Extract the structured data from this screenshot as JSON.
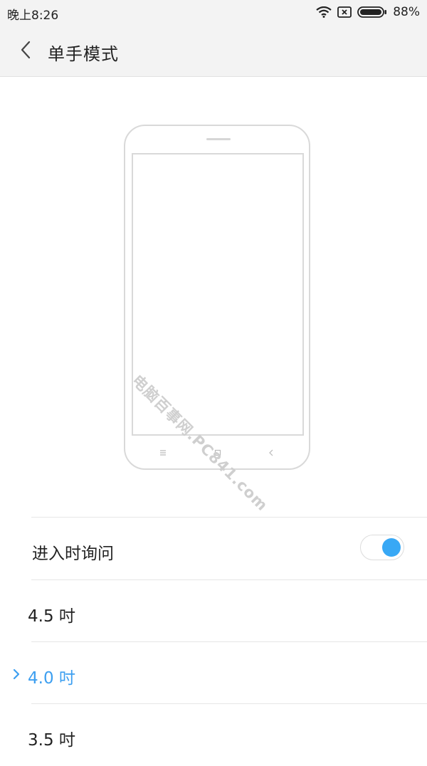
{
  "status_bar": {
    "time": "晚上8:26",
    "battery_percent": "88%",
    "icons": [
      "wifi-icon",
      "no-sim-icon",
      "battery-icon"
    ]
  },
  "header": {
    "title": "单手模式",
    "back_icon": "chevron-left-icon"
  },
  "illustration": {
    "watermark": "电脑百事网.PC841.com",
    "nav_icons": [
      "menu-icon",
      "home-icon",
      "back-icon"
    ]
  },
  "settings": {
    "ask_on_enter": {
      "label": "进入时询问",
      "enabled": true
    },
    "sizes": [
      {
        "label": "4.5 吋",
        "selected": false
      },
      {
        "label": "4.0 吋",
        "selected": true
      },
      {
        "label": "3.5 吋",
        "selected": false
      }
    ]
  },
  "colors": {
    "accent": "#3d9ff0",
    "toggle_on": "#38a8f5",
    "header_bg": "#f3f3f3"
  }
}
